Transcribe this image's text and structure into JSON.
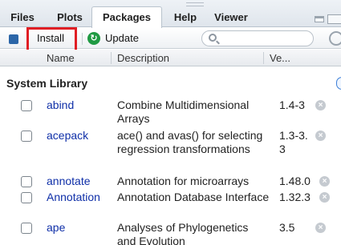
{
  "tabs": [
    {
      "label": "Files"
    },
    {
      "label": "Plots"
    },
    {
      "label": "Packages"
    },
    {
      "label": "Help"
    },
    {
      "label": "Viewer"
    }
  ],
  "toolbar": {
    "install_label": "Install",
    "update_label": "Update",
    "search_placeholder": ""
  },
  "columns": {
    "name": "Name",
    "description": "Description",
    "version": "Ve..."
  },
  "section_title": "System Library",
  "packages": [
    {
      "name": "abind",
      "description": "Combine Multidimensional Arrays",
      "version": "1.4-3"
    },
    {
      "name": "acepack",
      "description": "ace() and avas() for selecting regression transformations",
      "version": "1.3-3.3"
    },
    {
      "name": "annotate",
      "description": "Annotation for microarrays",
      "version": "1.48.0"
    },
    {
      "name": "Annotation",
      "description": "Annotation Database Interface",
      "version": "1.32.3"
    },
    {
      "name": "ape",
      "description": "Analyses of Phylogenetics and Evolution",
      "version": "3.5"
    }
  ],
  "colors": {
    "highlight": "#e01e24",
    "link": "#0f2fa8",
    "update_icon": "#1f9a43"
  }
}
